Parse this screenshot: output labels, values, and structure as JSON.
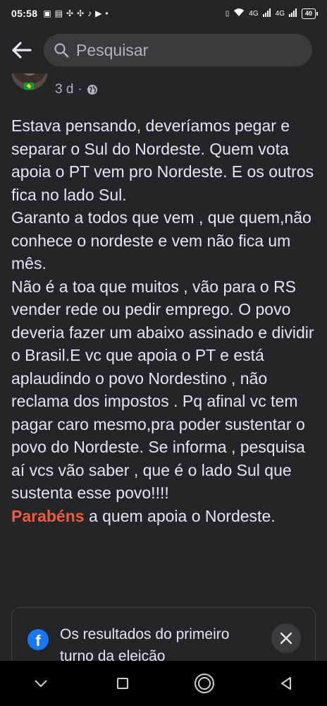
{
  "status_bar": {
    "time": "05:58",
    "battery": "40",
    "net1": "4G",
    "net2": "4G"
  },
  "search": {
    "placeholder": "Pesquisar"
  },
  "post": {
    "timestamp": "3 d",
    "separator": "·",
    "paragraphs": [
      "Estava pensando, deveríamos pegar e separar o Sul do Nordeste. Quem vota apoia o PT vem pro Nordeste. E os outros fica no lado Sul.",
      "Garanto a todos que vem , que quem,não conhece o nordeste e vem não fica um mês.",
      "Não é a toa que muitos , vão para o RS vender rede ou pedir emprego. O povo deveria fazer um abaixo assinado e dividir o Brasil.E vc que apoia o PT e está aplaudindo o povo Nordestino , não reclama dos impostos . Pq afinal vc tem pagar caro mesmo,pra poder sustentar o povo do Nordeste. Se informa , pesquisa aí vcs vão saber , que é o lado Sul que sustenta esse povo!!!!"
    ],
    "last_highlight": "Parabéns",
    "last_rest": " a quem apoia o Nordeste."
  },
  "card": {
    "text": "Os resultados do primeiro turno da eleição"
  },
  "colors": {
    "background": "#242526",
    "highlight": "#f05a44",
    "facebook_blue": "#1877f2"
  }
}
